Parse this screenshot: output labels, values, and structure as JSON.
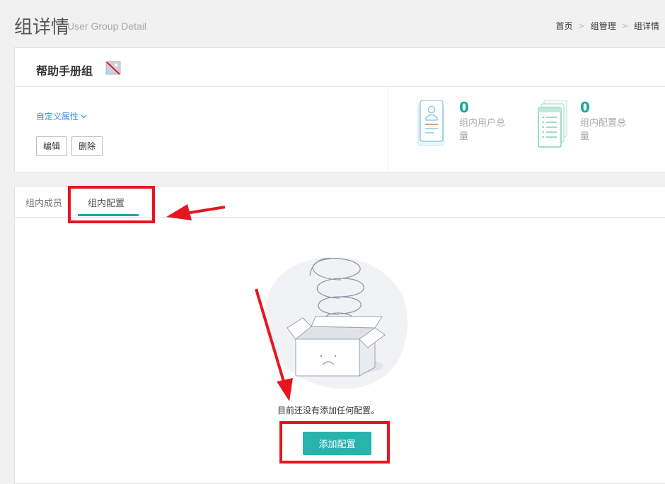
{
  "header": {
    "title": "组详情",
    "subtitle": "User Group Detail",
    "breadcrumb": [
      "首页",
      "组管理",
      "组详情"
    ]
  },
  "group": {
    "name": "帮助手册组",
    "custom_attr_label": "自定义属性",
    "edit_label": "编辑",
    "delete_label": "删除"
  },
  "stats": {
    "users": {
      "value": "0",
      "label": "组内用户总量"
    },
    "configs": {
      "value": "0",
      "label": "组内配置总量"
    }
  },
  "tabs": [
    {
      "label": "组内成员"
    },
    {
      "label": "组内配置",
      "active": true
    }
  ],
  "empty": {
    "message": "目前还没有添加任何配置。",
    "add_button": "添加配置"
  },
  "colors": {
    "accent": "#1aa89e",
    "button": "#26b4ad",
    "link": "#2d8cf0",
    "annotation": "#e6161f"
  }
}
